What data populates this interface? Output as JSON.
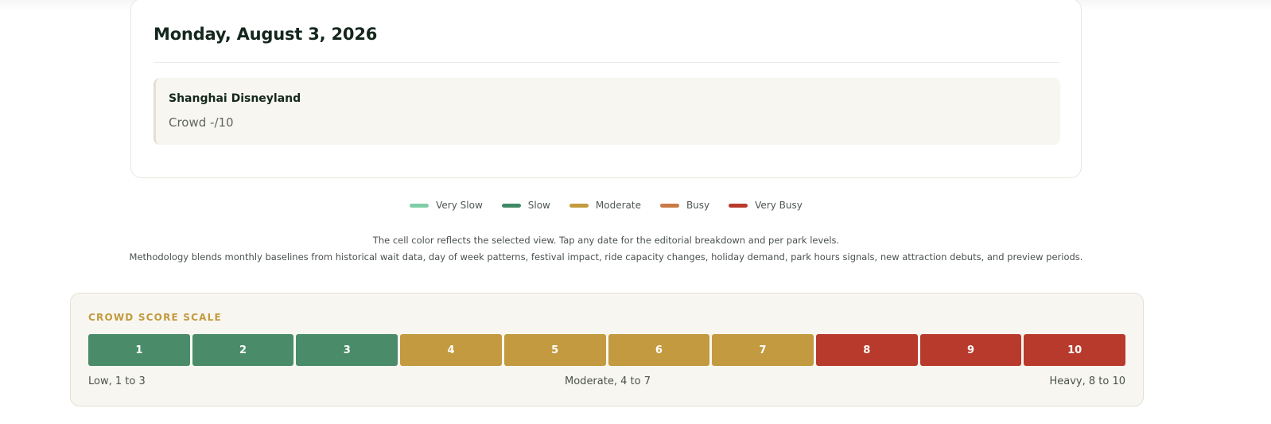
{
  "day": {
    "title": "Monday, August 3, 2026",
    "park": {
      "name": "Shanghai Disneyland",
      "crowd": "Crowd -/10"
    }
  },
  "legend": [
    {
      "label": "Very Slow",
      "color": "#7fcfa6"
    },
    {
      "label": "Slow",
      "color": "#3f8a64"
    },
    {
      "label": "Moderate",
      "color": "#c39a3f"
    },
    {
      "label": "Busy",
      "color": "#c87b45"
    },
    {
      "label": "Very Busy",
      "color": "#b83a2c"
    }
  ],
  "notes": {
    "line1": "The cell color reflects the selected view. Tap any date for the editorial breakdown and per park levels.",
    "line2": "Methodology blends monthly baselines from historical wait data, day of week patterns, festival impact, ride capacity changes, holiday demand, park hours signals, new attraction debuts, and preview periods."
  },
  "scale": {
    "heading": "CROWD SCORE SCALE",
    "cells": [
      {
        "label": "1",
        "color": "#4a8c6a"
      },
      {
        "label": "2",
        "color": "#4a8c6a"
      },
      {
        "label": "3",
        "color": "#4a8c6a"
      },
      {
        "label": "4",
        "color": "#c39a3f"
      },
      {
        "label": "5",
        "color": "#c39a3f"
      },
      {
        "label": "6",
        "color": "#c39a3f"
      },
      {
        "label": "7",
        "color": "#c39a3f"
      },
      {
        "label": "8",
        "color": "#b83a2c"
      },
      {
        "label": "9",
        "color": "#b83a2c"
      },
      {
        "label": "10",
        "color": "#b83a2c"
      }
    ],
    "low_label": "Low, 1 to 3",
    "mid_label": "Moderate, 4 to 7",
    "high_label": "Heavy, 8 to 10"
  }
}
